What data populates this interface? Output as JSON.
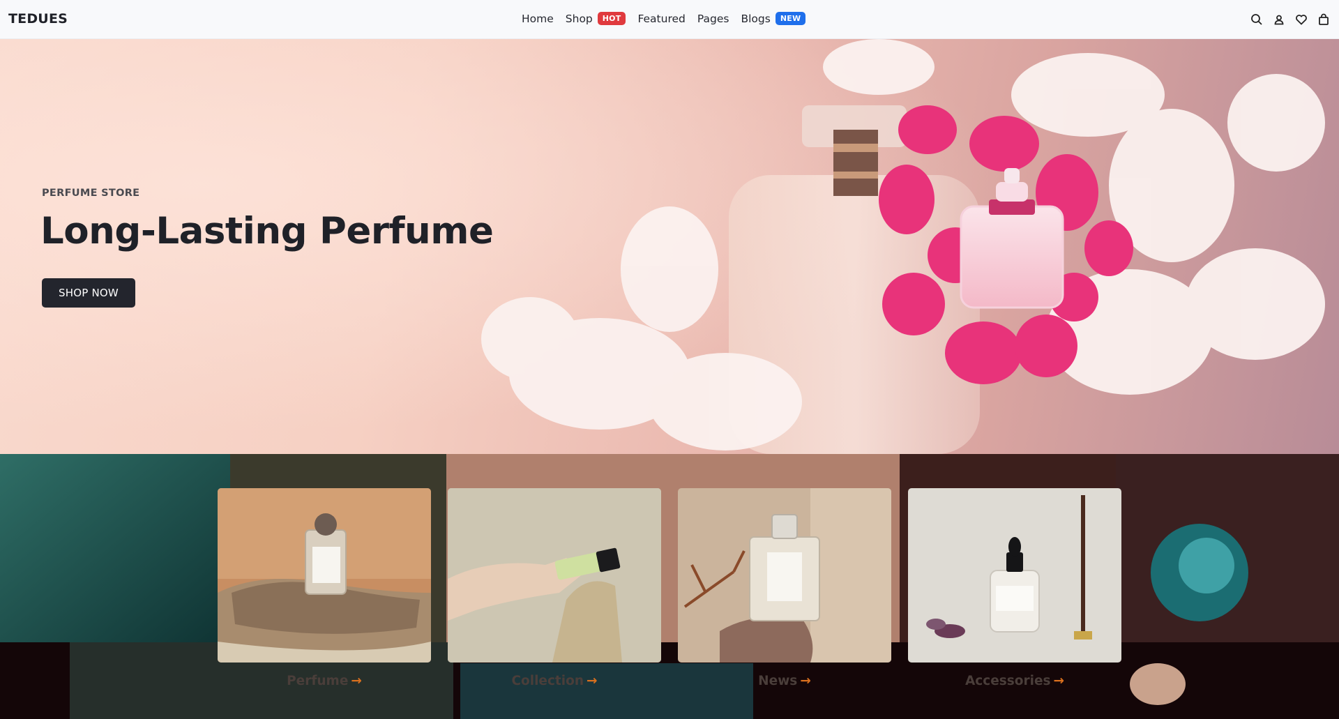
{
  "header": {
    "brand": "TEDUES",
    "nav": [
      {
        "label": "Home"
      },
      {
        "label": "Shop",
        "badge": "HOT"
      },
      {
        "label": "Featured"
      },
      {
        "label": "Pages"
      },
      {
        "label": "Blogs",
        "badge": "NEW"
      }
    ],
    "icons": [
      "search-icon",
      "user-icon",
      "heart-icon",
      "bag-icon"
    ]
  },
  "hero": {
    "subtitle": "PERFUME STORE",
    "title": "Long-Lasting Perfume",
    "button": "SHOP NOW"
  },
  "categories": [
    {
      "label": "Perfume",
      "arrow": "→"
    },
    {
      "label": "Collection",
      "arrow": "→"
    },
    {
      "label": "News",
      "arrow": "→"
    },
    {
      "label": "Accessories",
      "arrow": "→"
    }
  ],
  "colors": {
    "badge_hot": "#e03a3e",
    "badge_new": "#1f6feb",
    "button_dark": "#23252d",
    "arrow_accent": "#d9701e"
  }
}
